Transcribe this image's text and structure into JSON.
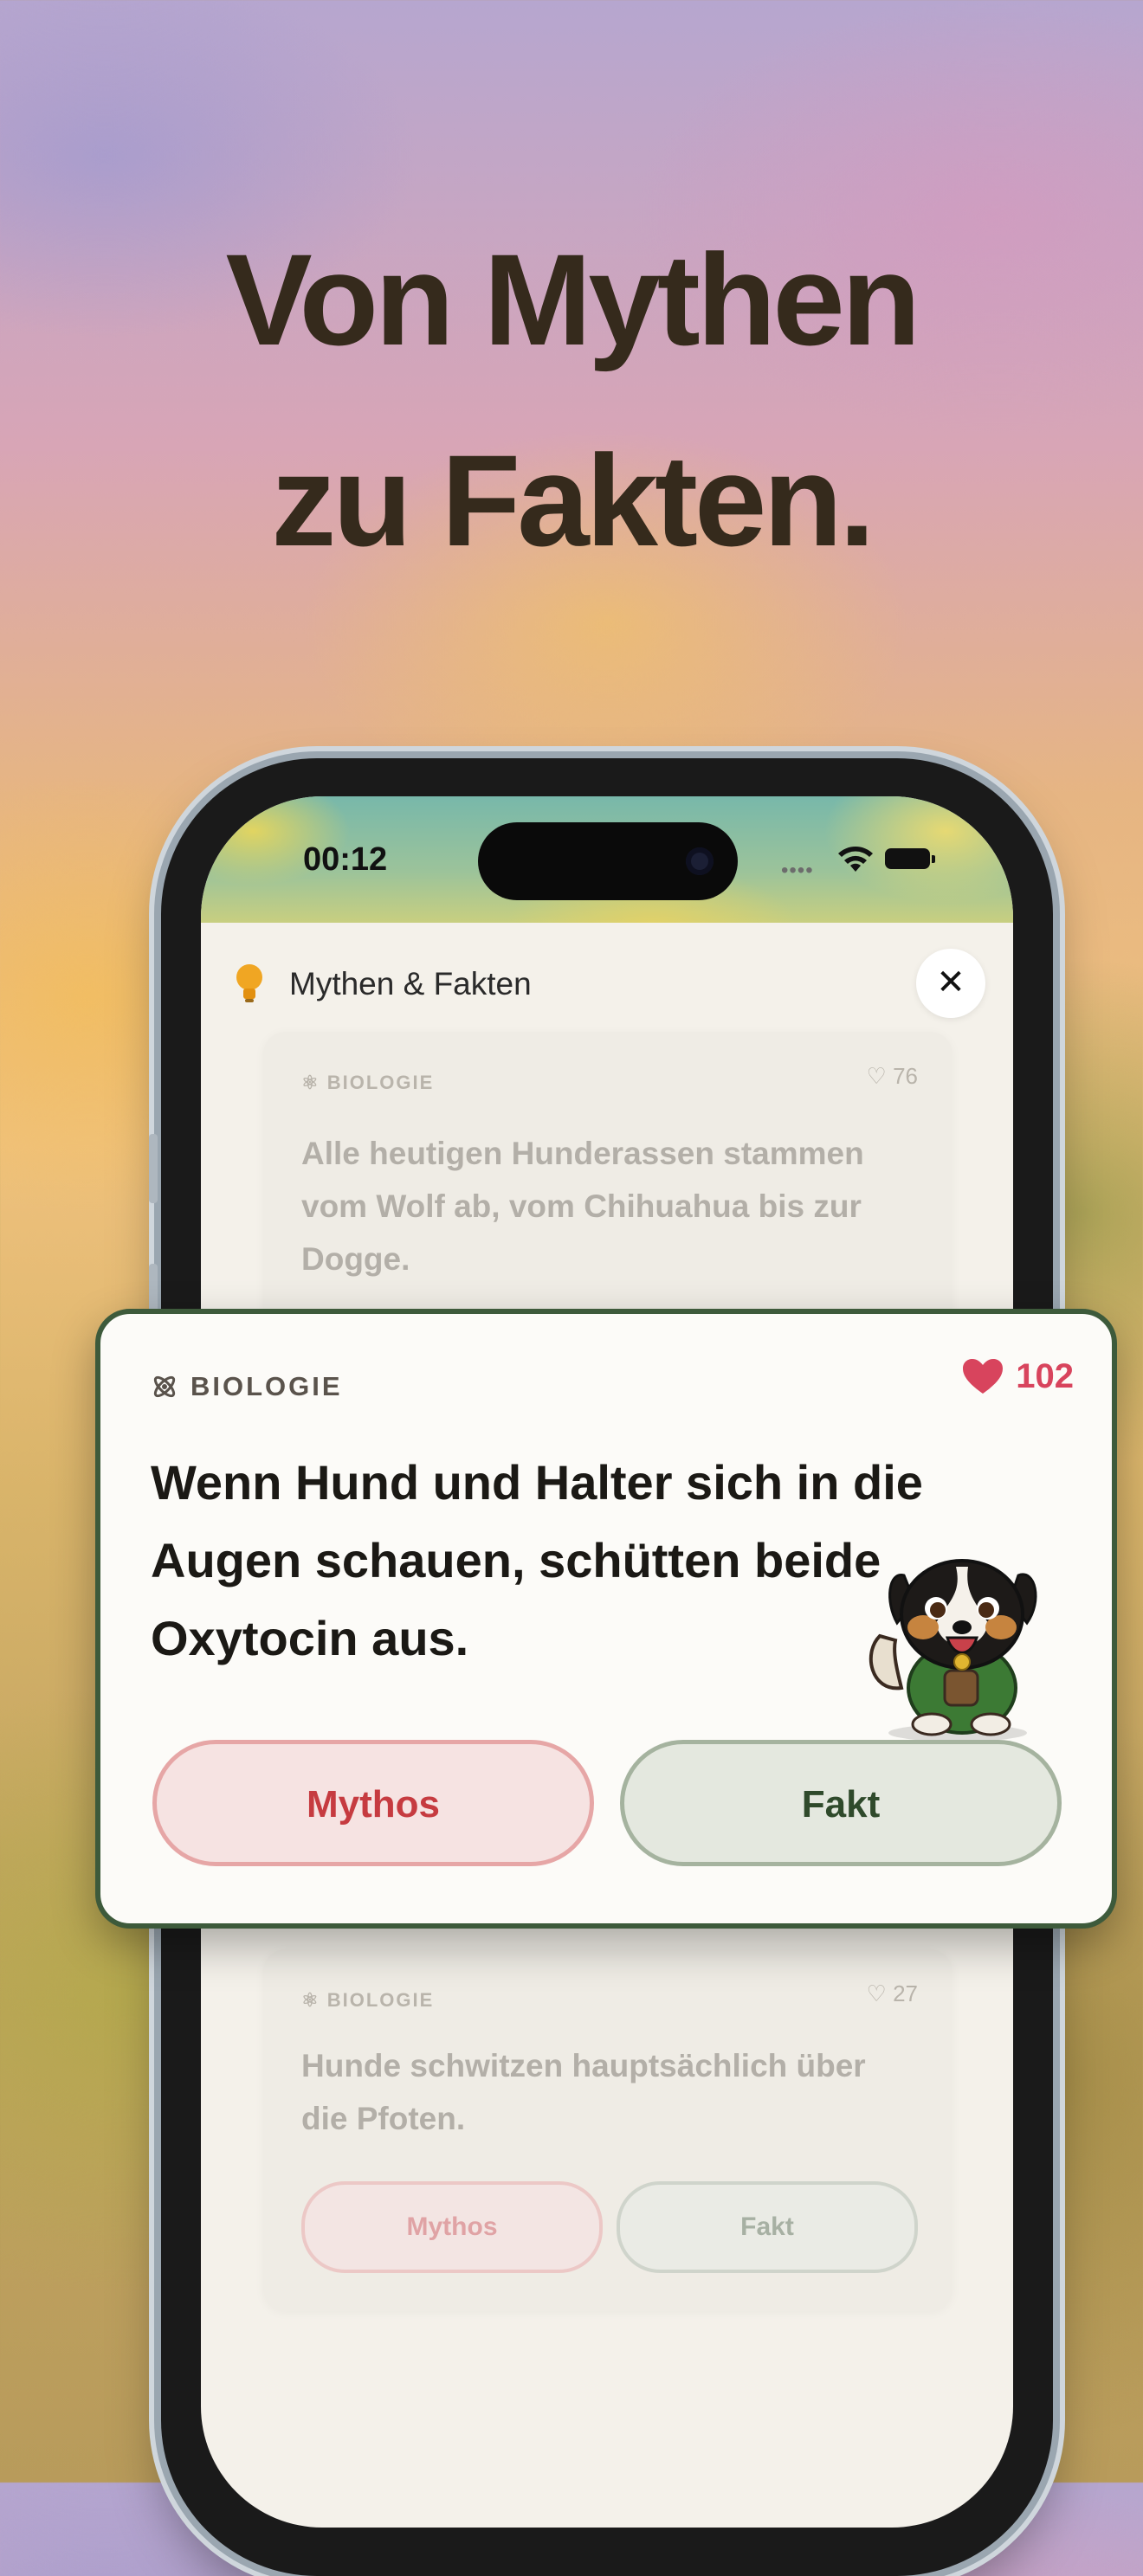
{
  "headline": {
    "line1": "Von Mythen",
    "line2": "zu Fakten."
  },
  "status_bar": {
    "time": "00:12"
  },
  "app": {
    "title": "Mythen & Fakten",
    "close_icon": "close-icon"
  },
  "cards": {
    "previous": {
      "category": "BIOLOGIE",
      "likes": "76",
      "text_line1": "Alle heutigen Hunderassen stammen",
      "text_line2": "vom Wolf ab, vom Chihuahua bis zur",
      "text_line3": "Dogge."
    },
    "current": {
      "category": "BIOLOGIE",
      "likes": "102",
      "text_line1": "Wenn Hund und Halter sich in die",
      "text_line2": "Augen schauen, schütten beide",
      "text_line3": "Oxytocin aus.",
      "myth_button": "Mythos",
      "fact_button": "Fakt"
    },
    "next": {
      "category": "BIOLOGIE",
      "likes": "27",
      "text_line1": "Hunde schwitzen hauptsächlich über",
      "text_line2": "die Pfoten.",
      "myth_button": "Mythos",
      "fact_button": "Fakt"
    }
  },
  "colors": {
    "headline": "#352a1c",
    "card_border": "#3d5a3b",
    "heart": "#d8445d",
    "myth": "#c63b40",
    "fact": "#2f4a2b"
  }
}
